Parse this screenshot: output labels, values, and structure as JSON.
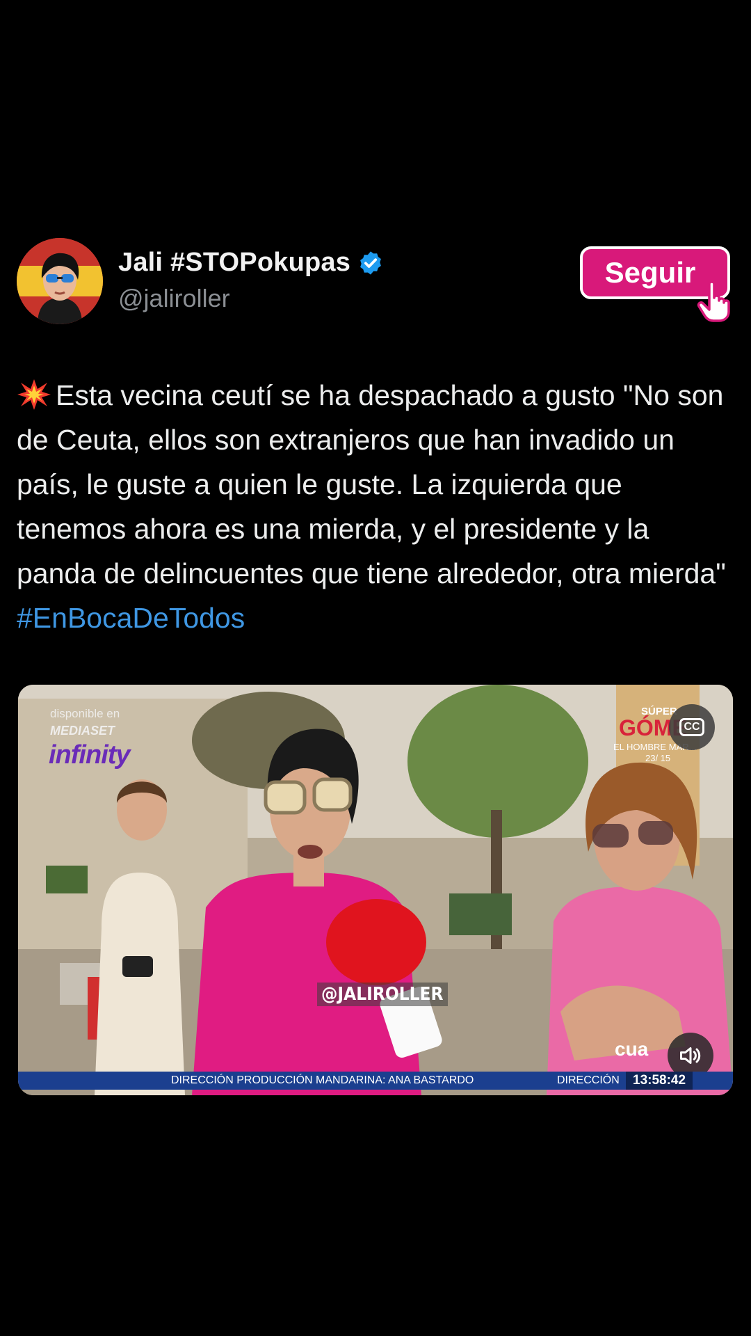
{
  "author": {
    "name": "Jali #STOPokupas",
    "handle": "@jaliroller",
    "verified": true
  },
  "follow_button": {
    "label": "Seguir"
  },
  "tweet": {
    "text": "Esta vecina ceutí se ha despachado a gusto \"No son de Ceuta, ellos son extranjeros que han invadido un país, le guste a quien le guste. La izquierda que tenemos ahora es una mierda, y el presidente y la panda de delincuentes que tiene alrededor, otra mierda\"",
    "hashtag": "#EnBocaDeTodos"
  },
  "video": {
    "watermark_line1": "disponible en",
    "watermark_line2": "MEDIASET",
    "watermark_line3": "infinity",
    "promo_line1": "SÚPER",
    "promo_line2": "GÓME",
    "promo_line3": "EL HOMBRE MAR...",
    "promo_line4": "23/ 15",
    "handle_overlay": "@JALIROLLER",
    "channel": "cua",
    "ticker_left": "DIRECCIÓN PRODUCCIÓN MANDARINA: ANA BASTARDO",
    "ticker_right": "DIRECCIÓN",
    "clock": "13:58:42",
    "cc_label": "CC"
  },
  "colors": {
    "background": "#000000",
    "follow_button": "#d8197a",
    "hashtag": "#3f97e3",
    "verified": "#1d9bf0"
  },
  "icons": [
    "avatar",
    "verified-badge-icon",
    "pointer-hand-icon",
    "collision-emoji-icon",
    "closed-captions-icon",
    "volume-icon"
  ]
}
